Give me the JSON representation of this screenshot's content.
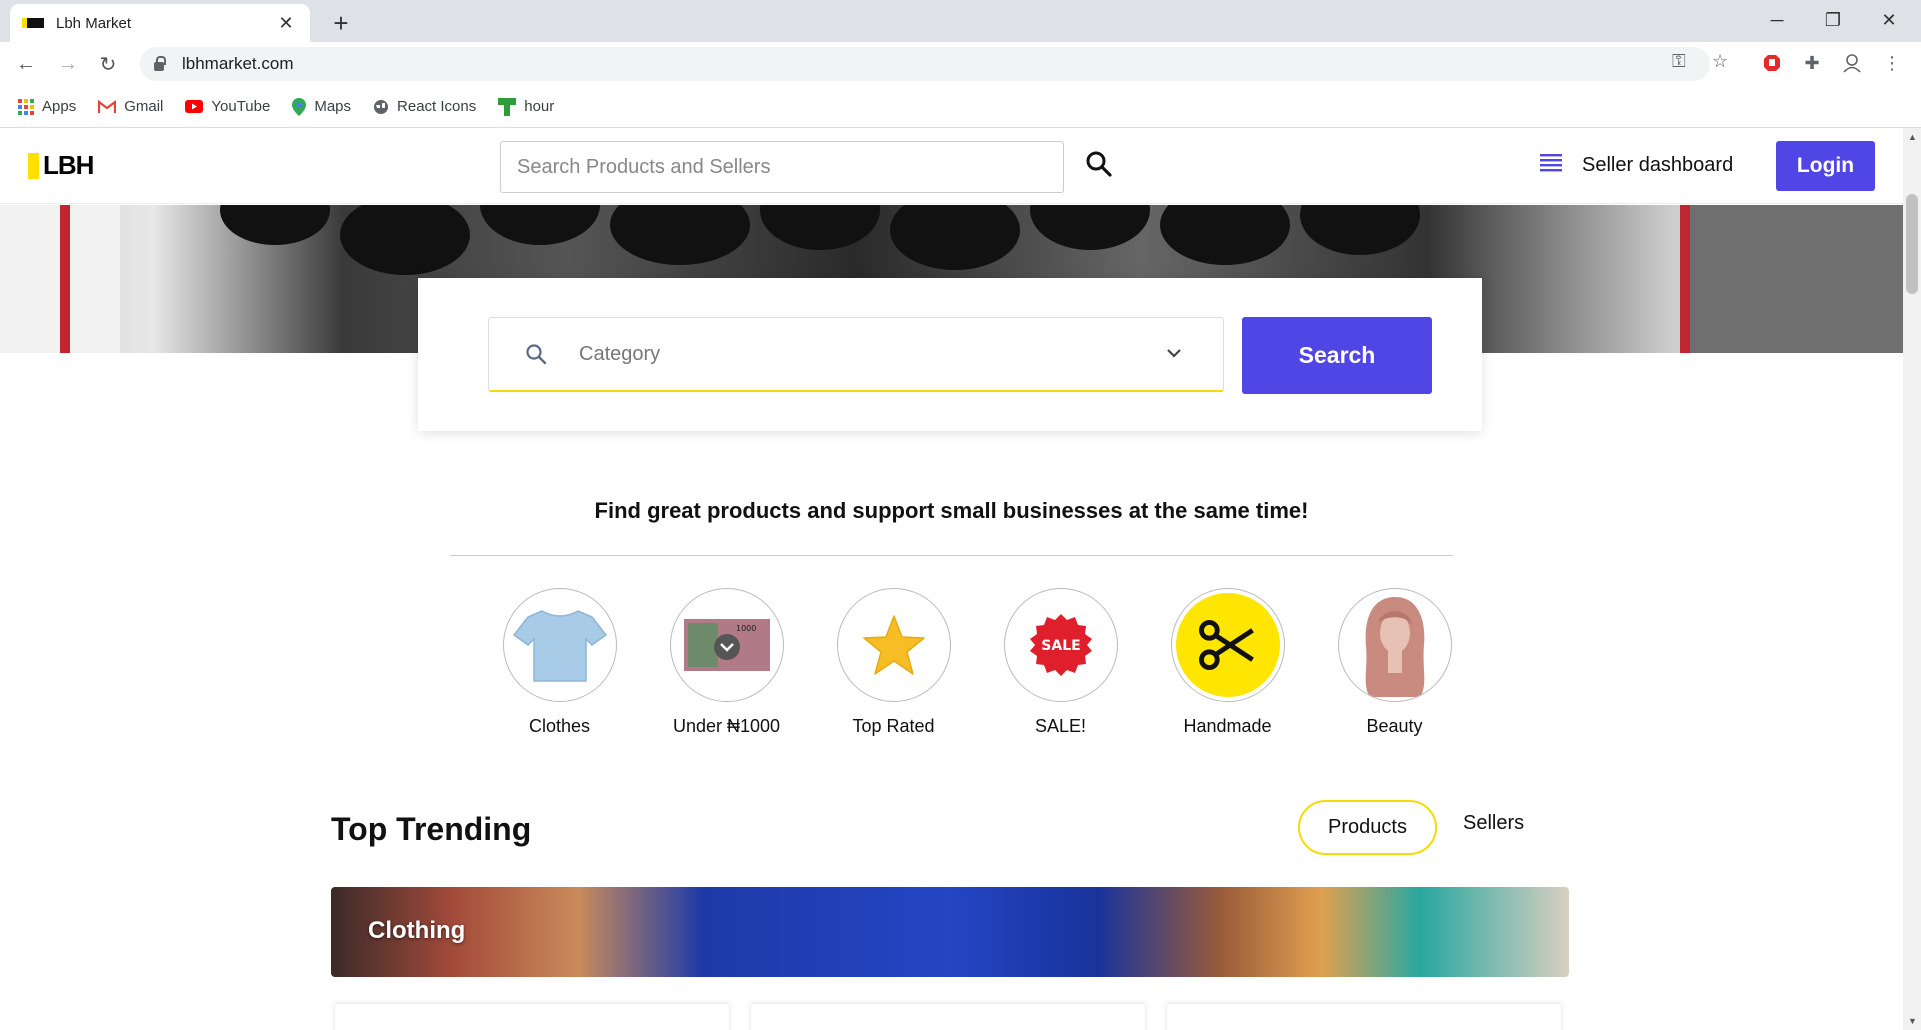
{
  "browser": {
    "tab_title": "Lbh Market",
    "url": "lbhmarket.com",
    "bookmarks": [
      "Apps",
      "Gmail",
      "YouTube",
      "Maps",
      "React Icons",
      "hour"
    ]
  },
  "header": {
    "logo_text": "LBH",
    "search_placeholder": "Search Products and Sellers",
    "seller_dashboard": "Seller dashboard",
    "login": "Login"
  },
  "hero_search": {
    "category_placeholder": "Category",
    "search_button": "Search"
  },
  "tagline": "Find great products and support small businesses at the same time!",
  "categories": [
    {
      "label": "Clothes",
      "icon": "tshirt-icon"
    },
    {
      "label": "Under ₦1000",
      "icon": "naira-note-icon"
    },
    {
      "label": "Top Rated",
      "icon": "star-icon"
    },
    {
      "label": "SALE!",
      "icon": "sale-badge-icon"
    },
    {
      "label": "Handmade",
      "icon": "scissors-icon"
    },
    {
      "label": "Beauty",
      "icon": "wig-icon"
    }
  ],
  "trending": {
    "title": "Top Trending",
    "tab_products": "Products",
    "tab_sellers": "Sellers",
    "banner_label": "Clothing"
  },
  "colors": {
    "accent": "#4f46e5",
    "brand_yellow": "#ffe000",
    "highlight": "#f5d90a"
  }
}
